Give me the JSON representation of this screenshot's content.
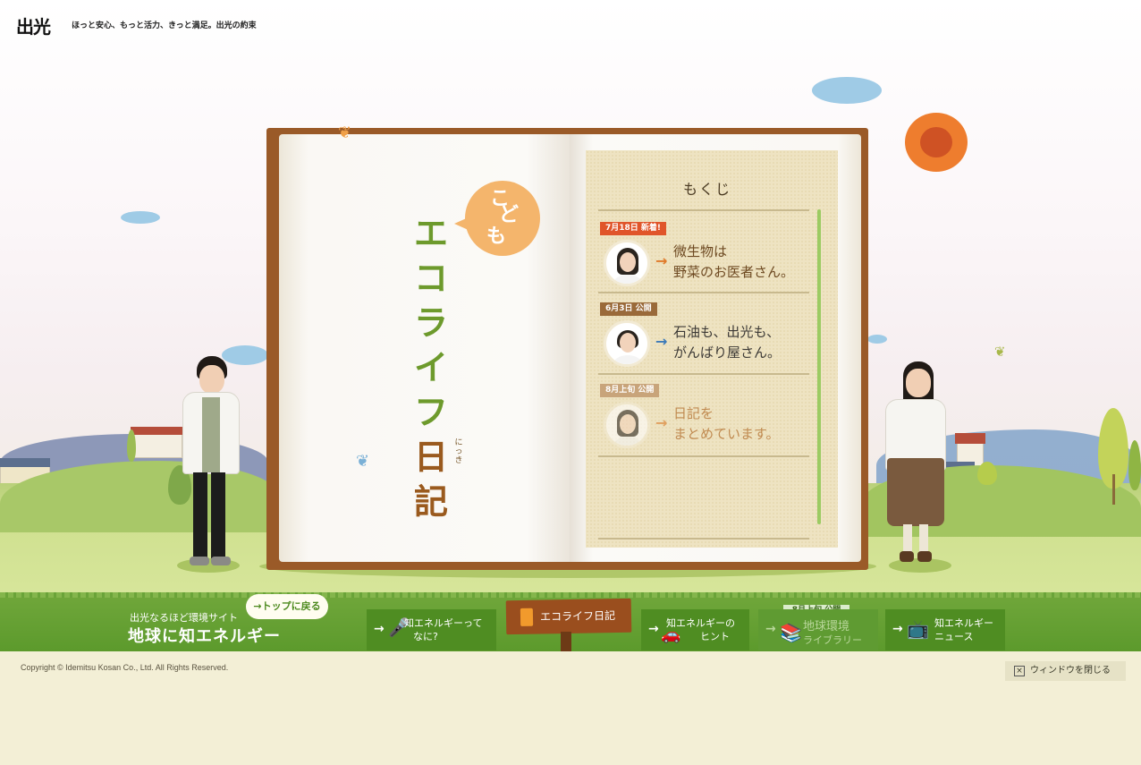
{
  "header": {
    "logo": "出光",
    "tagline": "ほっと安心、もっと活力、きっと満足。出光の約束"
  },
  "book": {
    "kodomo": [
      "こ",
      "ど",
      "も"
    ],
    "title_chars": [
      "エ",
      "コ",
      "ラ",
      "イ",
      "フ",
      "日",
      "記"
    ],
    "nikki_ruby": [
      "に",
      "っ",
      "き"
    ]
  },
  "toc": {
    "title": "もくじ",
    "items": [
      {
        "badge": "7月18日 新着!",
        "badge_color": "#e0552a",
        "arrow_color": "#e07a2a",
        "text_color": "#6e4a22",
        "lines": [
          "微生物は",
          "野菜のお医者さん。"
        ]
      },
      {
        "badge": "6月3日 公開",
        "badge_color": "#9a6a3a",
        "arrow_color": "#3c7ab8",
        "text_color": "#3d3a36",
        "lines": [
          "石油も、出光も、",
          "がんばり屋さん。"
        ]
      },
      {
        "badge": "8月上旬 公開",
        "badge_color": "#c8a47a",
        "arrow_color": "#e0a060",
        "text_color": "#c08a50",
        "lines": [
          "日記を",
          "まとめています。"
        ]
      }
    ]
  },
  "nav": {
    "site_sub": "出光なるほど環境サイト",
    "site_title": "地球に知エネルギー",
    "top_link": "トップに戻る",
    "items": [
      {
        "arrow": "→",
        "lines": [
          "知エネルギーって",
          "なに?"
        ]
      },
      {
        "label": "エコライフ日記"
      },
      {
        "arrow": "→",
        "lines": [
          "知エネルギーの",
          "ヒント"
        ]
      },
      {
        "arrow": "→",
        "badge": "8月上旬 公開",
        "lines": [
          "地球環境",
          "ライブラリー"
        ]
      },
      {
        "arrow": "→",
        "lines": [
          "知エネルギー",
          "ニュース"
        ]
      }
    ]
  },
  "footer": {
    "copyright": "Copyright © Idemitsu Kosan Co., Ltd. All Rights Reserved.",
    "close_label": "ウィンドウを閉じる"
  }
}
